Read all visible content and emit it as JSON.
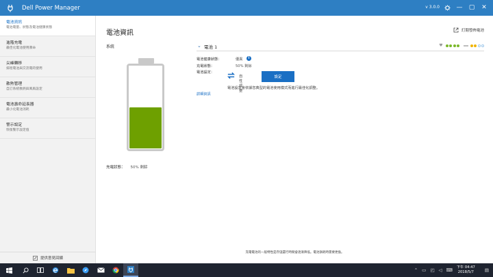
{
  "app": {
    "title": "Dell Power Manager",
    "version": "v 3.0.0"
  },
  "window_controls": {
    "settings_icon": "settings-icon",
    "minimize_glyph": "—",
    "maximize_glyph": "▢",
    "close_glyph": "✕"
  },
  "sidebar": {
    "items": [
      {
        "title": "電池資訊",
        "subtitle": "電池電量、狀態及電池健康狀態"
      },
      {
        "title": "進階充電",
        "subtitle": "最佳化電池使用壽命"
      },
      {
        "title": "尖峰轉移",
        "subtitle": "排程電池與交流電的使用"
      },
      {
        "title": "散熱管理",
        "subtitle": "自訂系統散熱與風扇設定"
      },
      {
        "title": "電池壽命延長器",
        "subtitle": "最小化電池消耗"
      },
      {
        "title": "警示設定",
        "subtitle": "恢復警示設定值"
      }
    ],
    "feedback_label": "提供意見回饋"
  },
  "main": {
    "title": "電池資訊",
    "subscribe_label": "訂閱發佈電池",
    "system_label": "系統",
    "system_charge_label": "充電狀態：",
    "system_charge_value": "50% 剩餘",
    "battery_fill_percent": 50,
    "battery": {
      "name": "電池 1",
      "health_label": "電池健康狀態：",
      "health_value": "優異",
      "charge_label": "充電狀態：",
      "charge_value": "50% 剩餘",
      "setting_label": "電池設定：",
      "setting_value": "自性調整",
      "setting_button": "設定",
      "description": "電池設定會依據您典型的電池使用模式而進行最佳化調整。",
      "details_link": "詳細資訊"
    },
    "footer_note": "充電電池的一般特性是存儲還行時間會逐漸降低。電池損耗時需要更換。"
  },
  "colors": {
    "titlebar": "#2e7fc3",
    "accent": "#1a6fc4",
    "battery_fill": "#6ea000",
    "health_dots": "#7ab829",
    "charge_dots": "#f0b400",
    "taskbar": "#1f2430"
  },
  "taskbar": {
    "icons": [
      "windows-start-icon",
      "search-icon",
      "task-view-icon",
      "edge-icon",
      "file-explorer-icon",
      "safari-icon",
      "mail-icon",
      "chrome-icon",
      "dell-power-manager-icon"
    ],
    "time": "下午 04:47",
    "date": "2018/5/7"
  }
}
